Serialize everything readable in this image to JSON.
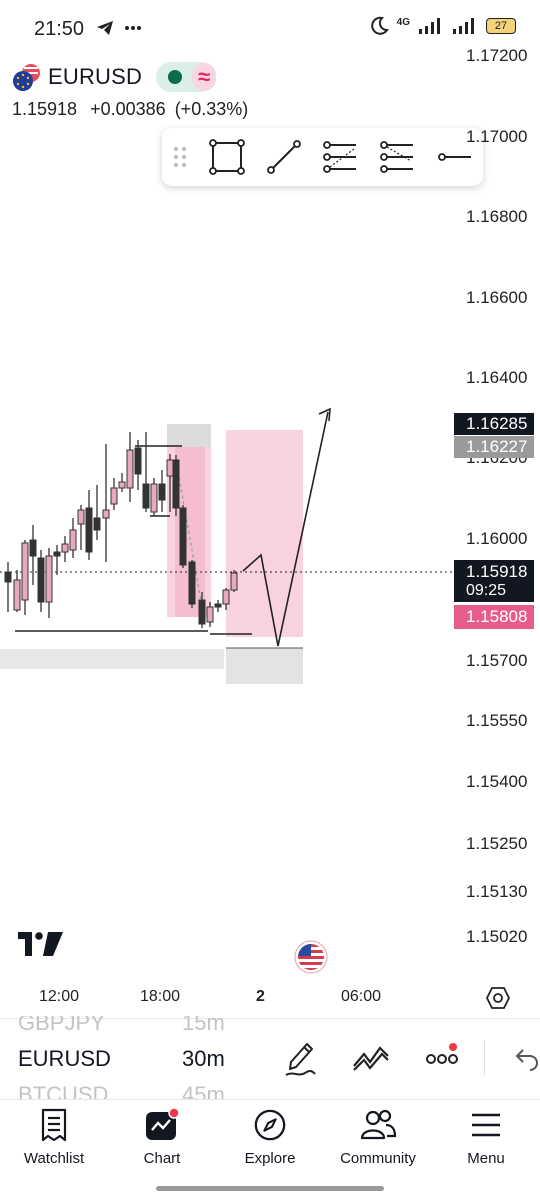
{
  "status_bar": {
    "time": "21:50",
    "network": "4G",
    "battery": "27"
  },
  "symbol": {
    "name": "EURUSD",
    "price": "1.15918",
    "change": "+0.00386",
    "change_pct": "(+0.33%)",
    "wave_glyph": "≈"
  },
  "price_axis": {
    "labels": [
      "1.17200",
      "1.17000",
      "1.16800",
      "1.16600",
      "1.16400",
      "1.16200",
      "1.16000",
      "1.15700",
      "1.15550",
      "1.15400",
      "1.15250",
      "1.15130",
      "1.15020"
    ],
    "tags": {
      "upper_1": "1.16285",
      "upper_2": "1.16227",
      "current": "1.15918",
      "countdown": "09:25",
      "lower": "1.15808"
    }
  },
  "time_axis": {
    "labels": [
      "12:00",
      "18:00",
      "2",
      "06:00"
    ]
  },
  "symbol_picker": {
    "prev": {
      "symbol": "GBPJPY",
      "interval": "15m"
    },
    "current": {
      "symbol": "EURUSD",
      "interval": "30m"
    },
    "next": {
      "symbol": "BTCUSD",
      "interval": "45m"
    }
  },
  "nav": {
    "items": [
      {
        "label": "Watchlist",
        "icon": "watchlist-icon"
      },
      {
        "label": "Chart",
        "icon": "chart-icon"
      },
      {
        "label": "Explore",
        "icon": "compass-icon"
      },
      {
        "label": "Community",
        "icon": "people-icon"
      },
      {
        "label": "Menu",
        "icon": "menu-icon"
      }
    ]
  },
  "colors": {
    "pink_zone": "#f8d0df",
    "pink_tag": "#e75c8b",
    "candle_bull": "#e8a9bf",
    "candle_bear": "#333333",
    "accent_red": "#f23645"
  }
}
